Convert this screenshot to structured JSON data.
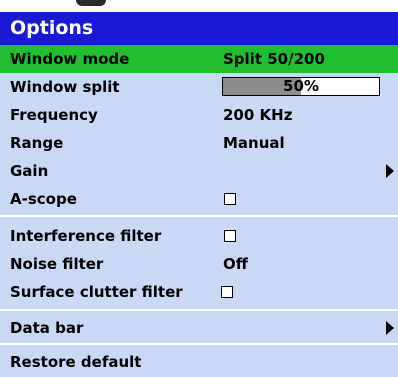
{
  "title": "Options",
  "rows": {
    "window_mode": {
      "label": "Window mode",
      "value": "Split 50/200"
    },
    "window_split": {
      "label": "Window split",
      "value_text": "50%",
      "level_percent": 50
    },
    "frequency": {
      "label": "Frequency",
      "value": "200 KHz"
    },
    "range": {
      "label": "Range",
      "value": "Manual"
    },
    "gain": {
      "label": "Gain"
    },
    "a_scope": {
      "label": "A-scope",
      "checked": false
    },
    "interference_filter": {
      "label": "Interference filter",
      "checked": false
    },
    "noise_filter": {
      "label": "Noise filter",
      "value": "Off"
    },
    "surface_clutter_filter": {
      "label": "Surface clutter filter",
      "checked": false
    },
    "data_bar": {
      "label": "Data bar"
    },
    "restore_default": {
      "label": "Restore default"
    }
  },
  "colors": {
    "title_bg": "#1a1ad6",
    "panel_bg": "#c8d8f5",
    "selected_bg": "#1fbf2e",
    "slider_fill": "#8c8c8c"
  },
  "icons": {
    "submenu_arrow": "triangle-right-icon",
    "checkbox": "checkbox-icon"
  }
}
